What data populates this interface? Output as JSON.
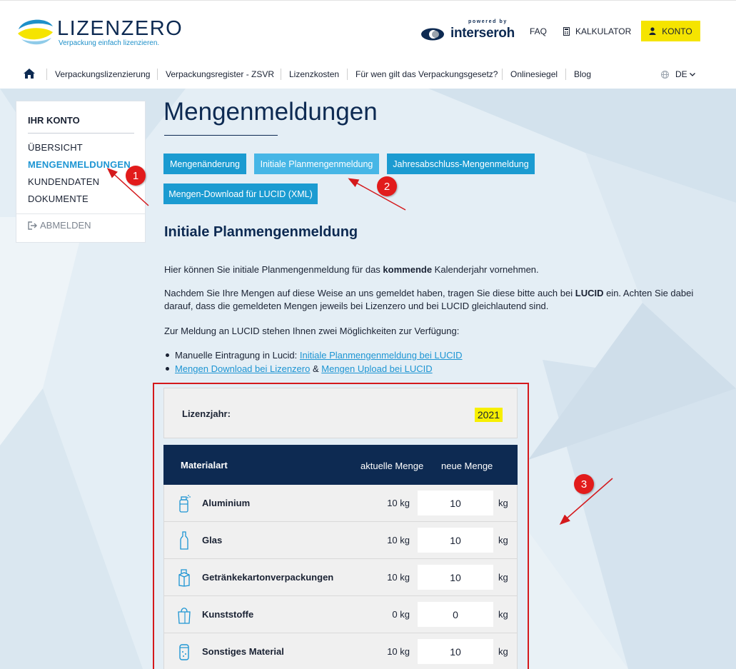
{
  "brand": {
    "name": "LIZENZERO",
    "tagline": "Verpackung einfach lizenzieren.",
    "powered_by": "powered by",
    "partner": "interseroh"
  },
  "topbar": {
    "faq": "FAQ",
    "calculator": "KALKULATOR",
    "account": "KONTO"
  },
  "nav": {
    "items": [
      {
        "label": "Verpackungslizenzierung"
      },
      {
        "label": "Verpackungsregister - ZSVR"
      },
      {
        "label": "Lizenzkosten"
      },
      {
        "label": "Für wen gilt das Verpackungsgesetz?"
      },
      {
        "label": "Onlinesiegel"
      },
      {
        "label": "Blog"
      }
    ],
    "language": "DE"
  },
  "sidebar": {
    "title": "IHR KONTO",
    "items": [
      {
        "label": "ÜBERSICHT"
      },
      {
        "label": "MENGENMELDUNGEN"
      },
      {
        "label": "KUNDENDATEN"
      },
      {
        "label": "DOKUMENTE"
      }
    ],
    "logout": "ABMELDEN"
  },
  "main": {
    "title": "Mengenmeldungen",
    "tabs": [
      {
        "label": "Mengenänderung"
      },
      {
        "label": "Initiale Planmengenmeldung"
      },
      {
        "label": "Jahresabschluss-Mengenmeldung"
      },
      {
        "label": "Mengen-Download für LUCID (XML)"
      }
    ],
    "section_title": "Initiale Planmengenmeldung",
    "p1_a": "Hier können Sie initiale Planmengenmeldung für das ",
    "p1_b": "kommende",
    "p1_c": " Kalenderjahr vornehmen.",
    "p2_a": "Nachdem Sie Ihre Mengen auf diese Weise an uns gemeldet haben, tragen Sie diese bitte auch bei ",
    "p2_b": "LUCID",
    "p2_c": " ein. Achten Sie dabei darauf, dass die gemeldeten Mengen jeweils bei Lizenzero und bei LUCID gleichlautend sind.",
    "p3": "Zur Meldung an LUCID stehen Ihnen zwei Möglichkeiten zur Verfügung:",
    "bullet1_text": "Manuelle Eintragung in Lucid: ",
    "bullet1_link": "Initiale Planmengenmeldung bei LUCID",
    "bullet2_link1": "Mengen Download bei Lizenzero",
    "bullet2_amp": " & ",
    "bullet2_link2": "Mengen Upload bei LUCID"
  },
  "table": {
    "year_label": "Lizenzjahr:",
    "year_value": "2021",
    "headers": {
      "material": "Materialart",
      "current": "aktuelle Menge",
      "new": "neue Menge"
    },
    "rows": [
      {
        "name": "Aluminium",
        "current": "10 kg",
        "new": "10",
        "unit": "kg",
        "icon": "spray-can-icon"
      },
      {
        "name": "Glas",
        "current": "10 kg",
        "new": "10",
        "unit": "kg",
        "icon": "bottle-icon"
      },
      {
        "name": "Getränkekartonverpackungen",
        "current": "10 kg",
        "new": "10",
        "unit": "kg",
        "icon": "carton-icon"
      },
      {
        "name": "Kunststoffe",
        "current": "0 kg",
        "new": "0",
        "unit": "kg",
        "icon": "plastic-bag-icon"
      },
      {
        "name": "Sonstiges Material",
        "current": "10 kg",
        "new": "10",
        "unit": "kg",
        "icon": "can-icon"
      }
    ]
  },
  "annotations": [
    "1",
    "2",
    "3"
  ],
  "colors": {
    "accent": "#1b9bd1",
    "navy": "#0d2a52",
    "yellow": "#f5e400",
    "annotation_red": "#e21b1b"
  }
}
